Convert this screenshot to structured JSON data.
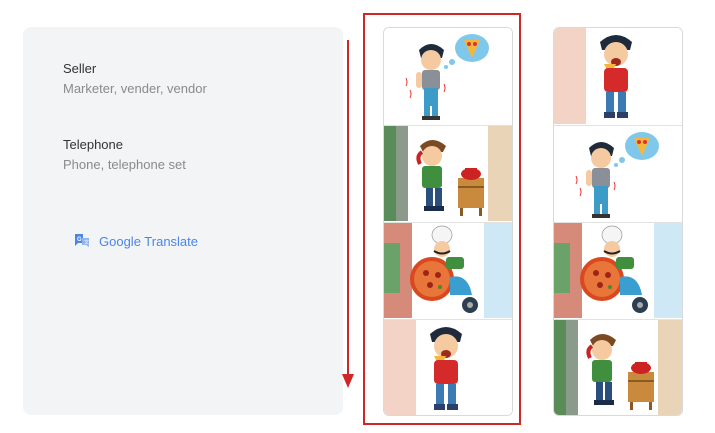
{
  "synonyms": [
    {
      "word": "Seller",
      "alternatives": "Marketer, vender, vendor"
    },
    {
      "word": "Telephone",
      "alternatives": "Phone, telephone set"
    }
  ],
  "translate_link": {
    "label": "Google Translate",
    "icon": "google-translate-icon"
  },
  "colors": {
    "accent": "#4a86e8",
    "highlight": "#d12626",
    "card_bg": "#f3f4f6"
  },
  "strips": [
    {
      "frames": [
        "boy-pizza-thought",
        "boy-telephone-cabinet",
        "chef-scooter-pizza",
        "boy-eating-pizza"
      ]
    },
    {
      "frames": [
        "boy-eating-pizza",
        "boy-pizza-thought",
        "chef-scooter-pizza",
        "boy-telephone-cabinet"
      ]
    }
  ]
}
